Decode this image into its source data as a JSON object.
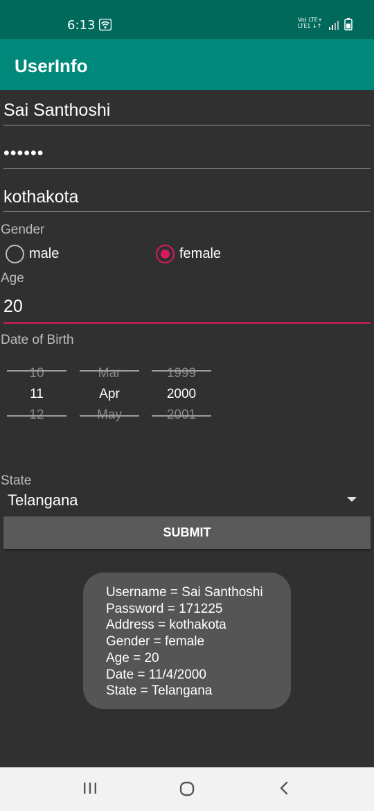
{
  "status_bar": {
    "time": "6:13",
    "network_line1": "Vo) LTE+",
    "network_line2": "LTE1 ↓↑"
  },
  "app_bar": {
    "title": "UserInfo"
  },
  "form": {
    "username": "Sai Santhoshi",
    "password_masked": "••••••",
    "address": "kothakota",
    "gender_label": "Gender",
    "gender_options": [
      "male",
      "female"
    ],
    "gender_selected": "female",
    "age_label": "Age",
    "age_value": "20",
    "dob_label": "Date of Birth",
    "dob_picker": {
      "day": [
        "10",
        "11",
        "12"
      ],
      "month": [
        "Mar",
        "Apr",
        "May"
      ],
      "year": [
        "1999",
        "2000",
        "2001"
      ]
    },
    "state_label": "State",
    "state_value": "Telangana",
    "submit_label": "SUBMIT"
  },
  "toast": {
    "lines": [
      "Username = Sai Santhoshi",
      "Password = 171225",
      "Address = kothakota",
      "Gender = female",
      "Age = 20",
      "Date = 11/4/2000",
      "State = Telangana"
    ]
  },
  "icons": {
    "wifi": "wifi-icon",
    "signal": "signal-icon",
    "battery": "battery-icon",
    "recents": "recents-icon",
    "home": "home-icon",
    "back": "back-icon"
  },
  "colors": {
    "status_bar": "#00695c",
    "app_bar": "#00897b",
    "accent": "#d81b60",
    "background": "#303030"
  }
}
